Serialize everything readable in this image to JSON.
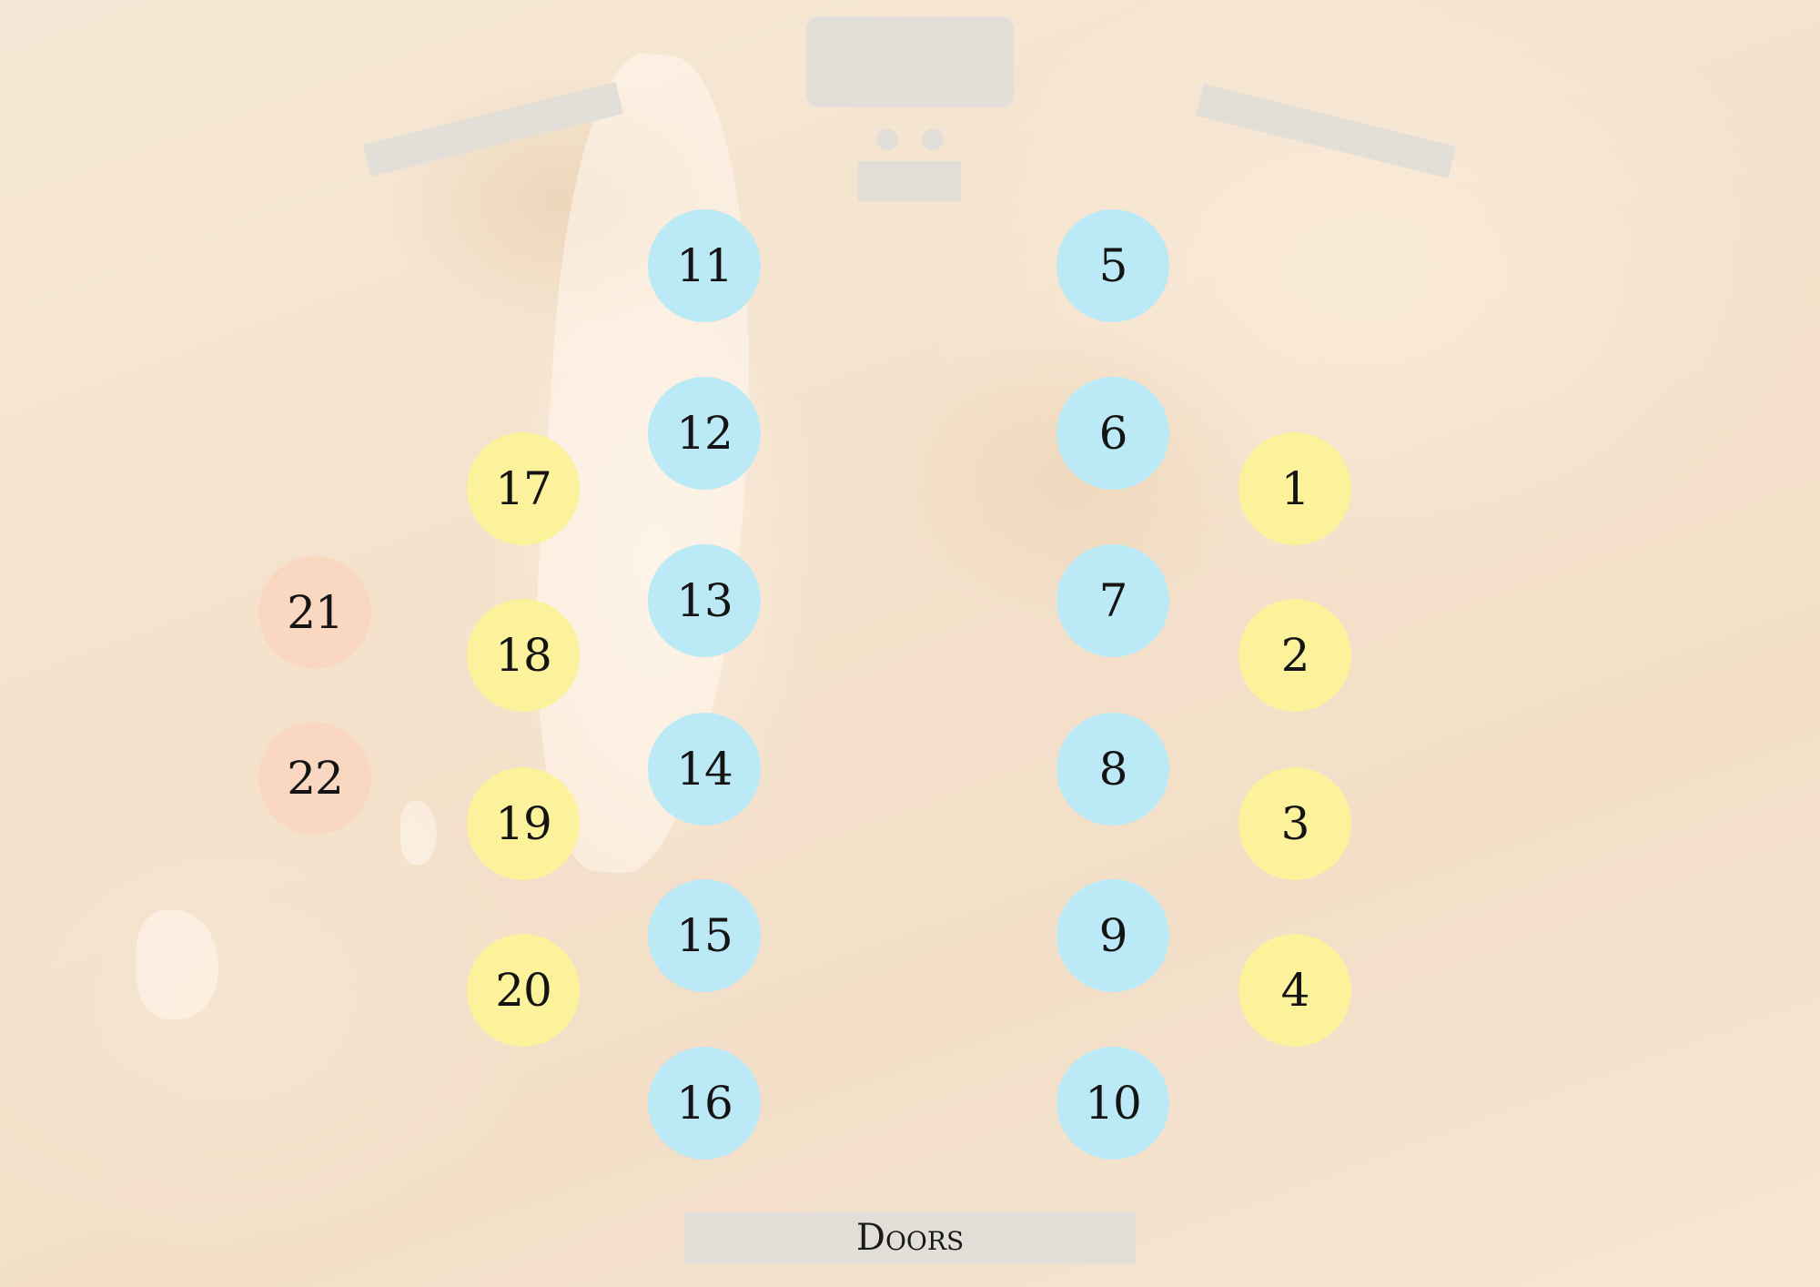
{
  "colors": {
    "blue": "#bbeaf6",
    "yellow": "#fbf29b",
    "peach": "#fad7c0",
    "furniture": "#e2dfd8"
  },
  "doors_label": "Doors",
  "tables": [
    {
      "number": "1",
      "color": "yellow"
    },
    {
      "number": "2",
      "color": "yellow"
    },
    {
      "number": "3",
      "color": "yellow"
    },
    {
      "number": "4",
      "color": "yellow"
    },
    {
      "number": "5",
      "color": "blue"
    },
    {
      "number": "6",
      "color": "blue"
    },
    {
      "number": "7",
      "color": "blue"
    },
    {
      "number": "8",
      "color": "blue"
    },
    {
      "number": "9",
      "color": "blue"
    },
    {
      "number": "10",
      "color": "blue"
    },
    {
      "number": "11",
      "color": "blue"
    },
    {
      "number": "12",
      "color": "blue"
    },
    {
      "number": "13",
      "color": "blue"
    },
    {
      "number": "14",
      "color": "blue"
    },
    {
      "number": "15",
      "color": "blue"
    },
    {
      "number": "16",
      "color": "blue"
    },
    {
      "number": "17",
      "color": "yellow"
    },
    {
      "number": "18",
      "color": "yellow"
    },
    {
      "number": "19",
      "color": "yellow"
    },
    {
      "number": "20",
      "color": "yellow"
    },
    {
      "number": "21",
      "color": "peach"
    },
    {
      "number": "22",
      "color": "peach"
    }
  ]
}
